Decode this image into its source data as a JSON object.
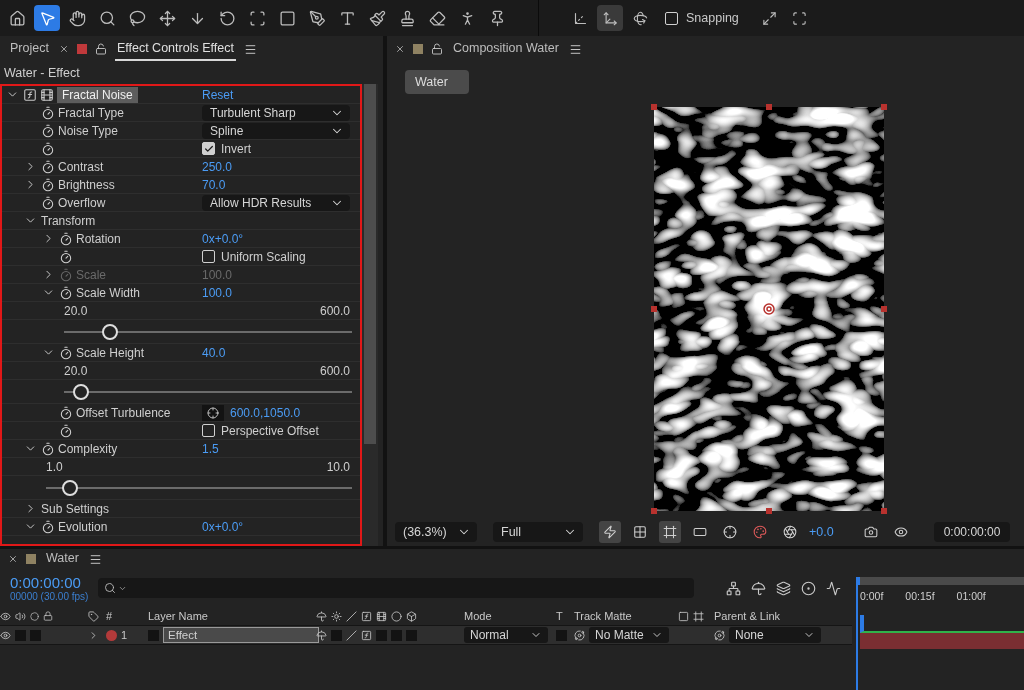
{
  "toolbar": {
    "tools": [
      {
        "kind": "home",
        "selected": false
      },
      {
        "kind": "select",
        "selected": true
      },
      {
        "kind": "hand",
        "selected": false
      },
      {
        "kind": "zoom",
        "selected": false
      },
      {
        "kind": "roto",
        "selected": false
      },
      {
        "kind": "anchor",
        "selected": false
      },
      {
        "kind": "pan",
        "selected": false
      },
      {
        "kind": "rotate",
        "selected": false
      },
      {
        "kind": "orbit",
        "selected": false
      },
      {
        "kind": "rectangle",
        "selected": false
      },
      {
        "kind": "pen",
        "selected": false
      },
      {
        "kind": "text",
        "selected": false
      },
      {
        "kind": "brush",
        "selected": false
      },
      {
        "kind": "stamp",
        "selected": false
      },
      {
        "kind": "eraser",
        "selected": false
      },
      {
        "kind": "puppet",
        "selected": false
      },
      {
        "kind": "pin",
        "selected": false
      }
    ],
    "axis_modes": [
      {
        "kind": "local",
        "selected": false
      },
      {
        "kind": "world",
        "selected": true
      },
      {
        "kind": "view",
        "selected": false
      }
    ],
    "snapping": {
      "label": "Snapping",
      "checked": false
    }
  },
  "effect_panel": {
    "tabs": [
      {
        "label": "Project",
        "selected": false
      },
      {
        "label": "Effect Controls Effect",
        "selected": true,
        "color": "#c0393b"
      }
    ],
    "breadcrumb": "Water - Effect",
    "effects": [
      {
        "kind": "effect",
        "label": "Fractal Noise",
        "value": "Reset",
        "expanded": true,
        "children": [
          {
            "kind": "dropdown",
            "label": "Fractal Type",
            "value": "Turbulent Sharp",
            "stopwatch": true
          },
          {
            "kind": "dropdown",
            "label": "Noise Type",
            "value": "Spline",
            "stopwatch": true
          },
          {
            "kind": "checkbox",
            "value": "Invert",
            "checked": true,
            "stopwatch": true
          },
          {
            "kind": "number",
            "label": "Contrast",
            "value": "250.0",
            "expanded": false,
            "stopwatch": true,
            "disabled": false
          },
          {
            "kind": "number",
            "label": "Brightness",
            "value": "70.0",
            "expanded": false,
            "stopwatch": true,
            "disabled": false
          },
          {
            "kind": "dropdown",
            "label": "Overflow",
            "value": "Allow HDR Results",
            "stopwatch": true
          },
          {
            "kind": "group",
            "label": "Transform",
            "expanded": true,
            "children": [
              {
                "kind": "number",
                "label": "Rotation",
                "value": "0x+0.0°",
                "expanded": false,
                "stopwatch": true,
                "disabled": false
              },
              {
                "kind": "checkbox",
                "value": "Uniform Scaling",
                "checked": false,
                "stopwatch": true
              },
              {
                "kind": "number",
                "label": "Scale",
                "value": "100.0",
                "expanded": false,
                "stopwatch": true,
                "disabled": true
              },
              {
                "kind": "number",
                "label": "Scale Width",
                "value": "100.0",
                "expanded": true,
                "stopwatch": true,
                "disabled": false,
                "slider": {
                  "min": "20.0",
                  "max": "600.0",
                  "level": 0.16
                }
              },
              {
                "kind": "number",
                "label": "Scale Height",
                "value": "40.0",
                "expanded": true,
                "stopwatch": true,
                "disabled": false,
                "slider": {
                  "min": "20.0",
                  "max": "600.0",
                  "level": 0.06
                }
              },
              {
                "kind": "point",
                "label": "Offset Turbulence",
                "value": "600.0,1050.0",
                "stopwatch": true
              },
              {
                "kind": "checkbox",
                "value": "Perspective Offset",
                "checked": false,
                "stopwatch": true
              }
            ]
          },
          {
            "kind": "number",
            "label": "Complexity",
            "value": "1.5",
            "expanded": true,
            "stopwatch": true,
            "disabled": false,
            "slider": {
              "min": "1.0",
              "max": "10.0",
              "level": 0.08
            }
          },
          {
            "kind": "group",
            "label": "Sub Settings",
            "expanded": false
          },
          {
            "kind": "number",
            "label": "Evolution",
            "value": "0x+0.0°",
            "expanded": true,
            "stopwatch": true,
            "disabled": false
          }
        ]
      }
    ]
  },
  "comp_panel": {
    "tab": {
      "label": "Composition Water",
      "color": "#8f8262"
    },
    "breadcrumb": "Water",
    "zoom": "(36.3%)",
    "resolution": "Full",
    "toggles": [
      {
        "kind": "fast-preview",
        "on": true
      },
      {
        "kind": "transparency",
        "on": false
      },
      {
        "kind": "mask",
        "on": true
      },
      {
        "kind": "region",
        "on": false
      },
      {
        "kind": "guides",
        "on": false
      }
    ],
    "exposure": "+0.0",
    "timecode": "0:00:00:00"
  },
  "timeline": {
    "tab": {
      "label": "Water",
      "color": "#8f8262"
    },
    "timecode": "0:00:00:00",
    "frame_info": "00000 (30.00 fps)",
    "columns": {
      "number": "#",
      "layer_name": "Layer Name",
      "mode": "Mode",
      "t": "T",
      "track_matte": "Track Matte",
      "parent": "Parent & Link"
    },
    "layers": [
      {
        "index": "1",
        "name": "Effect",
        "color": "#b33a3a",
        "visible": true,
        "expanded": false,
        "mode": "Normal",
        "track_matte": "No Matte",
        "parent": "None"
      }
    ],
    "ruler": [
      "0:00f",
      "00:15f",
      "01:00f"
    ]
  }
}
